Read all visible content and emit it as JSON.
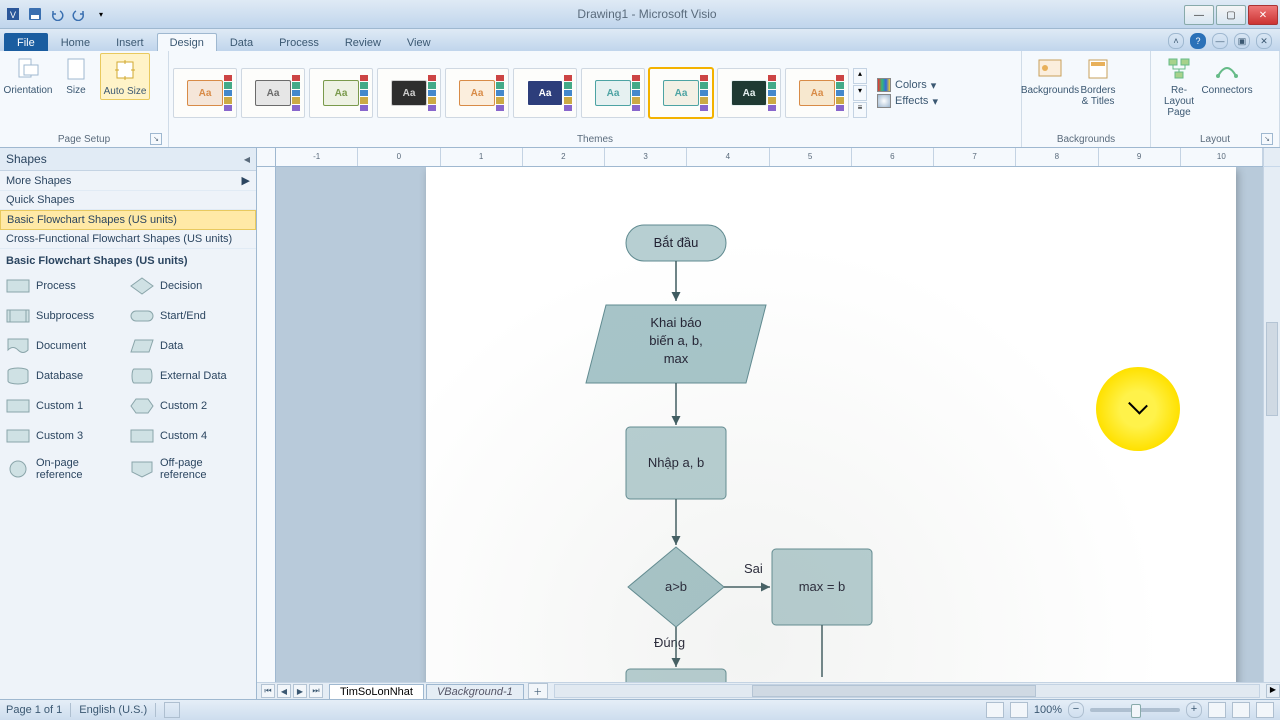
{
  "title": "Drawing1 - Microsoft Visio",
  "qat_icons": [
    "visio-icon",
    "save-icon",
    "undo-icon",
    "redo-icon",
    "qat-more-icon"
  ],
  "tabs": [
    "File",
    "Home",
    "Insert",
    "Design",
    "Data",
    "Process",
    "Review",
    "View"
  ],
  "active_tab": 3,
  "ribbon": {
    "page_setup": {
      "label": "Page Setup",
      "orientation": "Orientation",
      "size": "Size",
      "autosize": "Auto Size"
    },
    "themes_label": "Themes",
    "themes": [
      {
        "fg": "#d88b47",
        "bg": "#f5e6d9",
        "txt": "Aa"
      },
      {
        "fg": "#6b6b6b",
        "bg": "#e6e6e6",
        "txt": "Aa"
      },
      {
        "fg": "#7a9a4c",
        "bg": "#eef2e4",
        "txt": "Aa"
      },
      {
        "fg": "#cfcfcf",
        "bg": "#2e2e2e",
        "txt": "Aa"
      },
      {
        "fg": "#d88b47",
        "bg": "#fbeedd",
        "txt": "Aa"
      },
      {
        "fg": "#ffffff",
        "bg": "#2d3e7b",
        "txt": "Aa"
      },
      {
        "fg": "#4da3a3",
        "bg": "#e6f1f1",
        "txt": "Aa",
        "sel": false
      },
      {
        "fg": "#4da3a3",
        "bg": "#f3f0e5",
        "txt": "Aa",
        "sel": true
      },
      {
        "fg": "#e6f1f1",
        "bg": "#1f3a33",
        "txt": "Aa"
      },
      {
        "fg": "#d88b47",
        "bg": "#f7e8cf",
        "txt": "Aa"
      }
    ],
    "colors_label": "Colors",
    "effects_label": "Effects",
    "backgrounds": {
      "label": "Backgrounds",
      "backgrounds": "Backgrounds",
      "borders": "Borders & Titles"
    },
    "layout": {
      "label": "Layout",
      "relayout": "Re-Layout Page",
      "connectors": "Connectors"
    }
  },
  "shapes_pane": {
    "title": "Shapes",
    "more": "More Shapes",
    "quick": "Quick Shapes",
    "stencils": [
      "Basic Flowchart Shapes (US units)",
      "Cross-Functional Flowchart Shapes (US units)"
    ],
    "selected_stencil": 0,
    "section_title": "Basic Flowchart Shapes (US units)",
    "items": [
      {
        "name": "Process",
        "kind": "rect"
      },
      {
        "name": "Decision",
        "kind": "diamond"
      },
      {
        "name": "Subprocess",
        "kind": "rect2"
      },
      {
        "name": "Start/End",
        "kind": "pill"
      },
      {
        "name": "Document",
        "kind": "doc"
      },
      {
        "name": "Data",
        "kind": "para"
      },
      {
        "name": "Database",
        "kind": "db"
      },
      {
        "name": "External Data",
        "kind": "cyl"
      },
      {
        "name": "Custom 1",
        "kind": "rect"
      },
      {
        "name": "Custom 2",
        "kind": "hex"
      },
      {
        "name": "Custom 3",
        "kind": "rect"
      },
      {
        "name": "Custom 4",
        "kind": "rect"
      },
      {
        "name": "On-page reference",
        "kind": "circle"
      },
      {
        "name": "Off-page reference",
        "kind": "home"
      }
    ]
  },
  "canvas": {
    "sheet_tabs": [
      "TimSoLonNhat",
      "VBackground-1"
    ],
    "ruler_marks": [
      -1,
      0,
      1,
      2,
      3,
      4,
      5,
      6,
      7,
      8,
      9,
      10
    ],
    "nodes": {
      "start": "Bắt đầu",
      "declare": "Khai báo biến a, b, max",
      "input": "Nhập a, b",
      "cond": "a>b",
      "cond_true": "Đúng",
      "cond_false": "Sai",
      "maxb": "max = b"
    }
  },
  "status": {
    "page": "Page 1 of 1",
    "lang": "English (U.S.)",
    "zoom": "100%"
  }
}
